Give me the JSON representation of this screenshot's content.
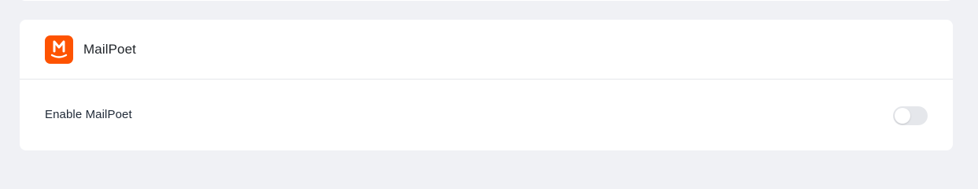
{
  "integration": {
    "title": "MailPoet",
    "logo_icon": "mailpoet-logo-icon",
    "brand_color": "#fe5301",
    "setting": {
      "label": "Enable MailPoet",
      "enabled": false
    }
  },
  "colors": {
    "page_background": "#f0f1f5",
    "card_background": "#ffffff",
    "toggle_off": "#e5e7eb"
  }
}
